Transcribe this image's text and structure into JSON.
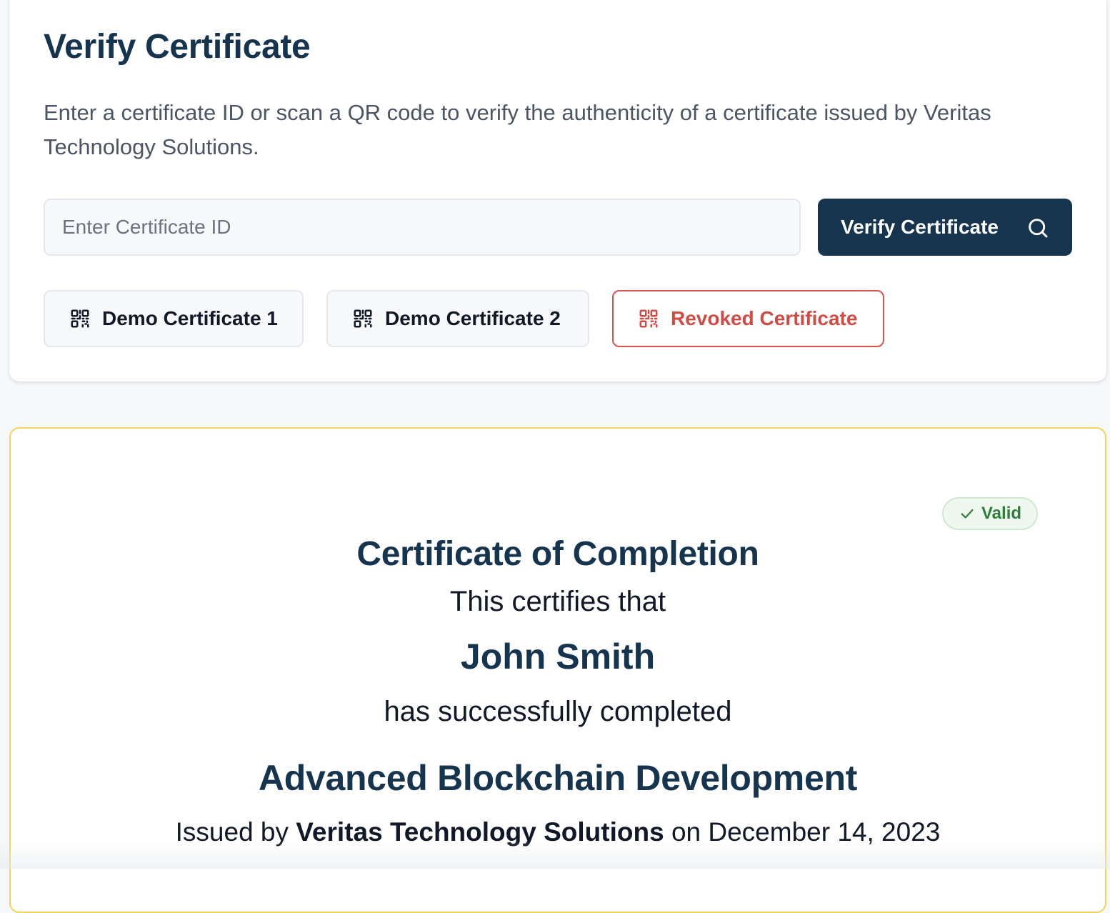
{
  "verify": {
    "title": "Verify Certificate",
    "description": "Enter a certificate ID or scan a QR code to verify the authenticity of a certificate issued by Veritas Technology Solutions.",
    "input_placeholder": "Enter Certificate ID",
    "input_value": "",
    "button_label": "Verify Certificate",
    "button_icon": "search-icon"
  },
  "demos": [
    {
      "label": "Demo Certificate 1",
      "icon": "qr-code-icon"
    },
    {
      "label": "Demo Certificate 2",
      "icon": "qr-code-icon"
    },
    {
      "label": "Revoked Certificate",
      "icon": "qr-code-icon",
      "color": "#d14b45"
    }
  ],
  "certificate": {
    "status": "Valid",
    "status_icon": "check-icon",
    "status_color": "#2f7d3a",
    "title": "Certificate of Completion",
    "certifies_text": "This certifies that",
    "recipient": "John Smith",
    "completed_text": "has successfully completed",
    "course": "Advanced Blockchain Development",
    "issued_prefix": "Issued by",
    "issuer": "Veritas Technology Solutions",
    "issued_on": "on",
    "date": "December 14, 2023"
  },
  "colors": {
    "primary": "#17344f",
    "danger": "#d14b45",
    "success": "#2f7d3a",
    "certificate_border": "#f2d35e"
  }
}
